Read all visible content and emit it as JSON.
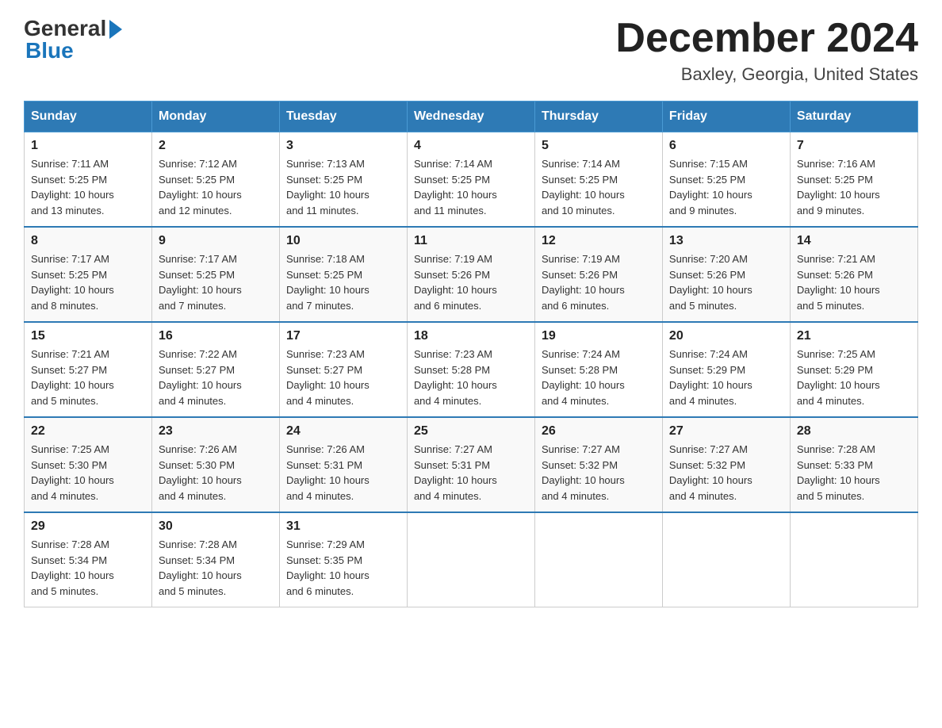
{
  "logo": {
    "general": "General",
    "blue": "Blue"
  },
  "header": {
    "month": "December 2024",
    "location": "Baxley, Georgia, United States"
  },
  "days_of_week": [
    "Sunday",
    "Monday",
    "Tuesday",
    "Wednesday",
    "Thursday",
    "Friday",
    "Saturday"
  ],
  "weeks": [
    [
      {
        "day": "1",
        "sunrise": "7:11 AM",
        "sunset": "5:25 PM",
        "daylight": "10 hours and 13 minutes."
      },
      {
        "day": "2",
        "sunrise": "7:12 AM",
        "sunset": "5:25 PM",
        "daylight": "10 hours and 12 minutes."
      },
      {
        "day": "3",
        "sunrise": "7:13 AM",
        "sunset": "5:25 PM",
        "daylight": "10 hours and 11 minutes."
      },
      {
        "day": "4",
        "sunrise": "7:14 AM",
        "sunset": "5:25 PM",
        "daylight": "10 hours and 11 minutes."
      },
      {
        "day": "5",
        "sunrise": "7:14 AM",
        "sunset": "5:25 PM",
        "daylight": "10 hours and 10 minutes."
      },
      {
        "day": "6",
        "sunrise": "7:15 AM",
        "sunset": "5:25 PM",
        "daylight": "10 hours and 9 minutes."
      },
      {
        "day": "7",
        "sunrise": "7:16 AM",
        "sunset": "5:25 PM",
        "daylight": "10 hours and 9 minutes."
      }
    ],
    [
      {
        "day": "8",
        "sunrise": "7:17 AM",
        "sunset": "5:25 PM",
        "daylight": "10 hours and 8 minutes."
      },
      {
        "day": "9",
        "sunrise": "7:17 AM",
        "sunset": "5:25 PM",
        "daylight": "10 hours and 7 minutes."
      },
      {
        "day": "10",
        "sunrise": "7:18 AM",
        "sunset": "5:25 PM",
        "daylight": "10 hours and 7 minutes."
      },
      {
        "day": "11",
        "sunrise": "7:19 AM",
        "sunset": "5:26 PM",
        "daylight": "10 hours and 6 minutes."
      },
      {
        "day": "12",
        "sunrise": "7:19 AM",
        "sunset": "5:26 PM",
        "daylight": "10 hours and 6 minutes."
      },
      {
        "day": "13",
        "sunrise": "7:20 AM",
        "sunset": "5:26 PM",
        "daylight": "10 hours and 5 minutes."
      },
      {
        "day": "14",
        "sunrise": "7:21 AM",
        "sunset": "5:26 PM",
        "daylight": "10 hours and 5 minutes."
      }
    ],
    [
      {
        "day": "15",
        "sunrise": "7:21 AM",
        "sunset": "5:27 PM",
        "daylight": "10 hours and 5 minutes."
      },
      {
        "day": "16",
        "sunrise": "7:22 AM",
        "sunset": "5:27 PM",
        "daylight": "10 hours and 4 minutes."
      },
      {
        "day": "17",
        "sunrise": "7:23 AM",
        "sunset": "5:27 PM",
        "daylight": "10 hours and 4 minutes."
      },
      {
        "day": "18",
        "sunrise": "7:23 AM",
        "sunset": "5:28 PM",
        "daylight": "10 hours and 4 minutes."
      },
      {
        "day": "19",
        "sunrise": "7:24 AM",
        "sunset": "5:28 PM",
        "daylight": "10 hours and 4 minutes."
      },
      {
        "day": "20",
        "sunrise": "7:24 AM",
        "sunset": "5:29 PM",
        "daylight": "10 hours and 4 minutes."
      },
      {
        "day": "21",
        "sunrise": "7:25 AM",
        "sunset": "5:29 PM",
        "daylight": "10 hours and 4 minutes."
      }
    ],
    [
      {
        "day": "22",
        "sunrise": "7:25 AM",
        "sunset": "5:30 PM",
        "daylight": "10 hours and 4 minutes."
      },
      {
        "day": "23",
        "sunrise": "7:26 AM",
        "sunset": "5:30 PM",
        "daylight": "10 hours and 4 minutes."
      },
      {
        "day": "24",
        "sunrise": "7:26 AM",
        "sunset": "5:31 PM",
        "daylight": "10 hours and 4 minutes."
      },
      {
        "day": "25",
        "sunrise": "7:27 AM",
        "sunset": "5:31 PM",
        "daylight": "10 hours and 4 minutes."
      },
      {
        "day": "26",
        "sunrise": "7:27 AM",
        "sunset": "5:32 PM",
        "daylight": "10 hours and 4 minutes."
      },
      {
        "day": "27",
        "sunrise": "7:27 AM",
        "sunset": "5:32 PM",
        "daylight": "10 hours and 4 minutes."
      },
      {
        "day": "28",
        "sunrise": "7:28 AM",
        "sunset": "5:33 PM",
        "daylight": "10 hours and 5 minutes."
      }
    ],
    [
      {
        "day": "29",
        "sunrise": "7:28 AM",
        "sunset": "5:34 PM",
        "daylight": "10 hours and 5 minutes."
      },
      {
        "day": "30",
        "sunrise": "7:28 AM",
        "sunset": "5:34 PM",
        "daylight": "10 hours and 5 minutes."
      },
      {
        "day": "31",
        "sunrise": "7:29 AM",
        "sunset": "5:35 PM",
        "daylight": "10 hours and 6 minutes."
      },
      null,
      null,
      null,
      null
    ]
  ],
  "labels": {
    "sunrise": "Sunrise:",
    "sunset": "Sunset:",
    "daylight": "Daylight:"
  }
}
